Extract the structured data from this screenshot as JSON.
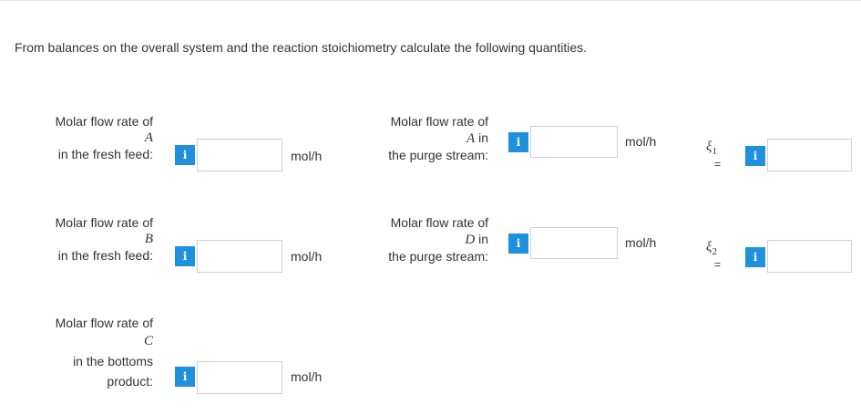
{
  "prompt": "From balances on the overall system and the reaction stoichiometry calculate the following quantities.",
  "info_glyph": "i",
  "left_rows": [
    {
      "line1": "Molar flow rate of",
      "var": "A",
      "line2": "in the fresh feed:",
      "unit": "mol/h",
      "value": ""
    },
    {
      "line1": "Molar flow rate of",
      "var": "B",
      "line2": "in the fresh feed:",
      "unit": "mol/h",
      "value": ""
    },
    {
      "line1": "Molar flow rate of",
      "var": "C",
      "line2": "in the bottoms",
      "line3": "product:",
      "unit": "mol/h",
      "value": ""
    }
  ],
  "mid_rows": [
    {
      "line1": "Molar flow rate of",
      "var": "A",
      "var_suffix": " in",
      "line2": "the purge stream:",
      "unit": "mol/h",
      "value": ""
    },
    {
      "line1": "Molar flow rate of",
      "var": "D",
      "var_suffix": " in",
      "line2": "the purge stream:",
      "unit": "mol/h",
      "value": ""
    }
  ],
  "extents": [
    {
      "symbol": "ξ",
      "sub": "1",
      "eq": "=",
      "value": ""
    },
    {
      "symbol": "ξ",
      "sub": "2",
      "eq": "=",
      "value": ""
    }
  ],
  "colors": {
    "info_button": "#1e90dd",
    "field_border": "#cfcfcf",
    "text": "#333333"
  }
}
